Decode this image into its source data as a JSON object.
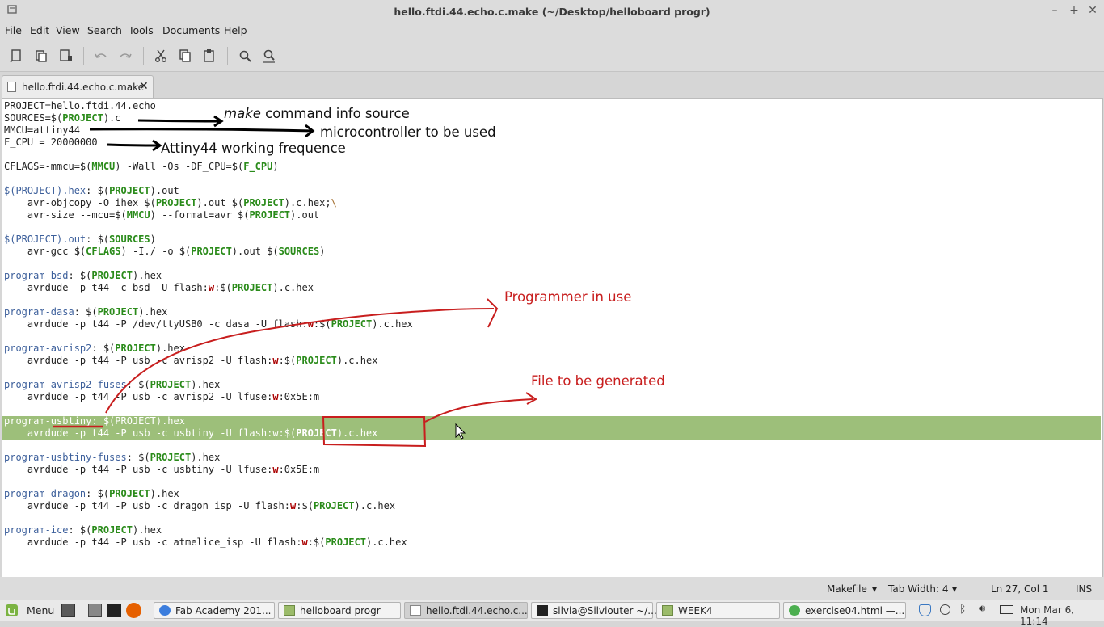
{
  "window": {
    "title": "hello.ftdi.44.echo.c.make (~/Desktop/helloboard progr)"
  },
  "menu": [
    "File",
    "Edit",
    "View",
    "Search",
    "Tools",
    "Documents",
    "Help"
  ],
  "toolbar_icons": [
    "new-document-icon",
    "open-icon",
    "save-icon",
    "undo-icon",
    "redo-icon",
    "cut-icon",
    "copy-icon",
    "paste-icon",
    "find-icon",
    "find-replace-icon"
  ],
  "tab": {
    "label": "hello.ftdi.44.echo.c.make"
  },
  "code": [
    [
      "PROJECT=hello.ftdi.44.echo"
    ],
    [
      "SOURCES=$(",
      {
        "v": "PROJECT"
      },
      ").c"
    ],
    [
      "MMCU=attiny44"
    ],
    [
      "F_CPU = 20000000"
    ],
    [
      ""
    ],
    [
      "CFLAGS=-mmcu=$(",
      {
        "v": "MMCU"
      },
      ") -Wall -Os -DF_CPU=$(",
      {
        "v": "F_CPU"
      },
      ")"
    ],
    [
      ""
    ],
    [
      {
        "t": "$(PROJECT).hex"
      },
      ": $(",
      {
        "v": "PROJECT"
      },
      ").out"
    ],
    [
      "    avr-objcopy -O ihex $(",
      {
        "v": "PROJECT"
      },
      ").out $(",
      {
        "v": "PROJECT"
      },
      ").c.hex;",
      {
        "e": "\\"
      }
    ],
    [
      "    avr-size --mcu=$(",
      {
        "v": "MMCU"
      },
      ") --format=avr $(",
      {
        "v": "PROJECT"
      },
      ").out"
    ],
    [
      ""
    ],
    [
      {
        "t": "$(PROJECT).out"
      },
      ": $(",
      {
        "v": "SOURCES"
      },
      ")"
    ],
    [
      "    avr-gcc $(",
      {
        "v": "CFLAGS"
      },
      ") -I./ -o $(",
      {
        "v": "PROJECT"
      },
      ").out $(",
      {
        "v": "SOURCES"
      },
      ")"
    ],
    [
      ""
    ],
    [
      {
        "t": "program-bsd"
      },
      ": $(",
      {
        "v": "PROJECT"
      },
      ").hex"
    ],
    [
      "    avrdude -p t44 -c bsd -U flash:",
      {
        "k": "w"
      },
      ":$(",
      {
        "v": "PROJECT"
      },
      ").c.hex"
    ],
    [
      ""
    ],
    [
      {
        "t": "program-dasa"
      },
      ": $(",
      {
        "v": "PROJECT"
      },
      ").hex"
    ],
    [
      "    avrdude -p t44 -P /dev/ttyUSB0 -c dasa -U flash:",
      {
        "k": "w"
      },
      ":$(",
      {
        "v": "PROJECT"
      },
      ").c.hex"
    ],
    [
      ""
    ],
    [
      {
        "t": "program-avrisp2"
      },
      ": $(",
      {
        "v": "PROJECT"
      },
      ").hex"
    ],
    [
      "    avrdude -p t44 -P usb -c avrisp2 -U flash:",
      {
        "k": "w"
      },
      ":$(",
      {
        "v": "PROJECT"
      },
      ").c.hex"
    ],
    [
      ""
    ],
    [
      {
        "t": "program-avrisp2-fuses"
      },
      ": $(",
      {
        "v": "PROJECT"
      },
      ").hex"
    ],
    [
      "    avrdude -p t44 -P usb -c avrisp2 -U lfuse:",
      {
        "k": "w"
      },
      ":0x5E:m"
    ],
    [
      ""
    ],
    [
      {
        "x": "program-usbtiny: $(PROJECT).hex"
      }
    ],
    [
      {
        "x": "    avrdude -p t44 -P usb -c usbtiny -U flash:w:$("
      },
      {
        "xb": "PROJECT"
      },
      {
        "x": ").c.hex"
      }
    ],
    [
      ""
    ],
    [
      {
        "t": "program-usbtiny-fuses"
      },
      ": $(",
      {
        "v": "PROJECT"
      },
      ").hex"
    ],
    [
      "    avrdude -p t44 -P usb -c usbtiny -U lfuse:",
      {
        "k": "w"
      },
      ":0x5E:m"
    ],
    [
      ""
    ],
    [
      {
        "t": "program-dragon"
      },
      ": $(",
      {
        "v": "PROJECT"
      },
      ").hex"
    ],
    [
      "    avrdude -p t44 -P usb -c dragon_isp -U flash:",
      {
        "k": "w"
      },
      ":$(",
      {
        "v": "PROJECT"
      },
      ").c.hex"
    ],
    [
      ""
    ],
    [
      {
        "t": "program-ice"
      },
      ": $(",
      {
        "v": "PROJECT"
      },
      ").hex"
    ],
    [
      "    avrdude -p t44 -P usb -c atmelice_isp -U flash:",
      {
        "k": "w"
      },
      ":$(",
      {
        "v": "PROJECT"
      },
      ").c.hex"
    ]
  ],
  "annotations": {
    "make_italic": "make",
    "make_rest": " command info source",
    "mcu": "microcontroller to be used",
    "freq": "Attiny44 working frequence",
    "programmer": "Programmer in use",
    "file": "File to be generated"
  },
  "status": {
    "language": "Makefile",
    "tab_width": "Tab Width: 4",
    "position": "Ln 27, Col 1",
    "mode": "INS"
  },
  "taskbar": {
    "menu_label": "Menu",
    "tasks": [
      {
        "icon": "chrome-icon",
        "label": "Fab Academy 201..."
      },
      {
        "icon": "folder-icon",
        "label": "helloboard progr"
      },
      {
        "icon": "text-editor-icon",
        "label": "hello.ftdi.44.echo.c..."
      },
      {
        "icon": "terminal-icon",
        "label": "silvia@Silviouter ~/..."
      },
      {
        "icon": "folder-icon",
        "label": "WEEK4"
      },
      {
        "icon": "browser-icon",
        "label": "exercise04.html —..."
      }
    ],
    "clock": "Mon Mar 6, 11:14"
  }
}
